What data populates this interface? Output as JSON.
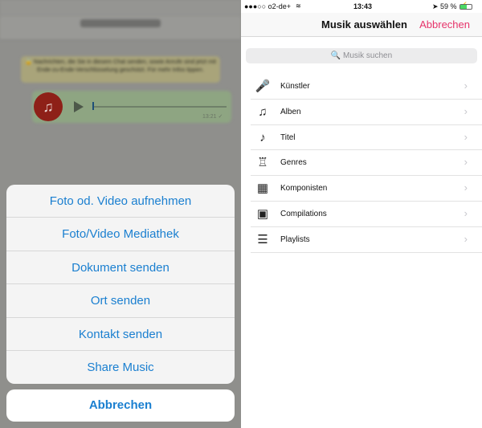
{
  "left": {
    "notice": "🔒 Nachrichten, die Sie in diesem Chat senden, sowie Anrufe sind jetzt mit Ende-zu-Ende-Verschlüsselung geschützt. Für mehr Infos tippen.",
    "audio_message": {
      "time": "13:21 ✓",
      "icon": "music-note-icon",
      "progress": 0
    },
    "action_sheet": {
      "items": [
        "Foto od. Video aufnehmen",
        "Foto/Video Mediathek",
        "Dokument senden",
        "Ort senden",
        "Kontakt senden",
        "Share Music"
      ],
      "cancel": "Abbrechen"
    }
  },
  "right": {
    "status": {
      "carrier": "●●●○○ o2-de+",
      "wifi": "wifi-icon",
      "time": "13:43",
      "battery": "➤ 59 %",
      "battery_level": 0.59
    },
    "nav": {
      "title": "Musik auswählen",
      "cancel": "Abbrechen"
    },
    "search": {
      "placeholder": "🔍 Musik suchen"
    },
    "items": [
      {
        "label": "Künstler",
        "icon": "🎤"
      },
      {
        "label": "Alben",
        "icon": "♫"
      },
      {
        "label": "Titel",
        "icon": "♪"
      },
      {
        "label": "Genres",
        "icon": "♖"
      },
      {
        "label": "Komponisten",
        "icon": "▦"
      },
      {
        "label": "Compilations",
        "icon": "▣"
      },
      {
        "label": "Playlists",
        "icon": "☰"
      }
    ],
    "chevron": "›"
  },
  "colors": {
    "accent_left": "#1a7fd0",
    "accent_right": "#e6336a"
  }
}
